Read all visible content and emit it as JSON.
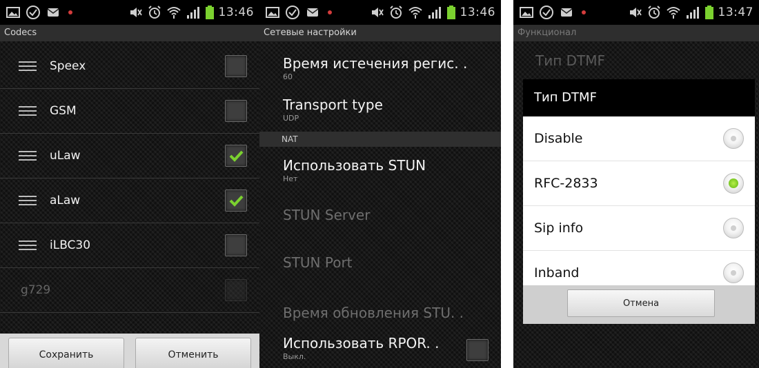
{
  "status": {
    "clock_left": "13:46",
    "clock_middle": "13:46",
    "clock_right": "13:47"
  },
  "codecs_screen": {
    "title": "Codecs",
    "rows": [
      {
        "label": "Speex",
        "checked": false
      },
      {
        "label": "GSM",
        "checked": false
      },
      {
        "label": "uLaw",
        "checked": true
      },
      {
        "label": "aLaw",
        "checked": true
      },
      {
        "label": "iLBC30",
        "checked": false
      },
      {
        "label": "g729",
        "checked": false,
        "disabled": true
      }
    ],
    "save_label": "Сохранить",
    "cancel_label": "Отменить"
  },
  "network_screen": {
    "title": "Сетевые настройки",
    "reg_expiry": {
      "title": "Время истечения регис. .",
      "summary": "60"
    },
    "transport": {
      "title": "Transport type",
      "summary": "UDP"
    },
    "nat_section": "NAT",
    "use_stun": {
      "title": "Использовать STUN",
      "summary": "Нет"
    },
    "stun_server": {
      "title": "STUN Server"
    },
    "stun_port": {
      "title": "STUN Port"
    },
    "stun_refresh": {
      "title": "Время обновления STU. ."
    },
    "use_rport": {
      "title": "Использовать RPOR. .",
      "summary": "Выкл."
    }
  },
  "dtmf_screen": {
    "title": "Функционал",
    "bg_pref_title": "Тип DTMF",
    "dialog": {
      "title": "Тип DTMF",
      "options": [
        {
          "label": "Disable",
          "selected": false
        },
        {
          "label": "RFC-2833",
          "selected": true
        },
        {
          "label": "Sip info",
          "selected": false
        },
        {
          "label": "Inband",
          "selected": false
        }
      ],
      "cancel_label": "Отмена"
    }
  },
  "colors": {
    "check_green": "#7bd12f",
    "radio_green": "#6cc51b"
  }
}
